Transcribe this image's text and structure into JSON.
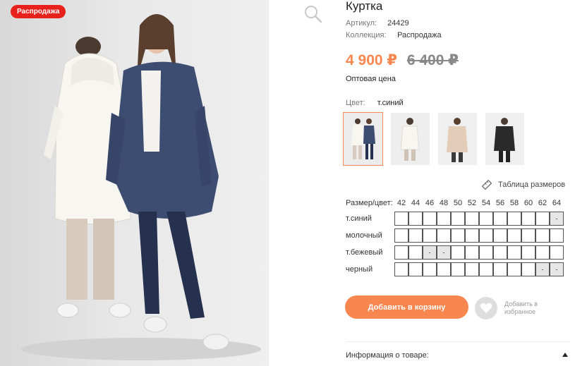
{
  "product": {
    "badge": "Распродажа",
    "title": "Куртка",
    "article_label": "Артикул:",
    "article_value": "24429",
    "collection_label": "Коллекция:",
    "collection_value": "Распродажа",
    "price_new": "4 900 ₽",
    "price_old": "6 400 ₽",
    "wholesale_label": "Оптовая цена",
    "color_label": "Цвет:",
    "color_value": "т.синий"
  },
  "colors": {
    "accent": "#f7864f",
    "badge": "#e8211c"
  },
  "swatches": [
    {
      "name": "т.синий",
      "selected": true
    },
    {
      "name": "молочный",
      "selected": false
    },
    {
      "name": "т.бежевый",
      "selected": false
    },
    {
      "name": "черный",
      "selected": false
    }
  ],
  "size_table_link": "Таблица размеров",
  "sizes": {
    "header_label": "Размер/цвет:",
    "columns": [
      "42",
      "44",
      "46",
      "48",
      "50",
      "52",
      "54",
      "56",
      "58",
      "60",
      "62",
      "64"
    ],
    "rows": [
      {
        "label": "т.синий",
        "cells": [
          "",
          "",
          "",
          "",
          "",
          "",
          "",
          "",
          "",
          "",
          "",
          "-"
        ]
      },
      {
        "label": "молочный",
        "cells": [
          "",
          "",
          "",
          "",
          "",
          "",
          "",
          "",
          "",
          "",
          "",
          ""
        ]
      },
      {
        "label": "т.бежевый",
        "cells": [
          "",
          "",
          "-",
          "-",
          "",
          "",
          "",
          "",
          "",
          "",
          "",
          ""
        ]
      },
      {
        "label": "черный",
        "cells": [
          "",
          "",
          "",
          "",
          "",
          "",
          "",
          "",
          "",
          "",
          "-",
          "-"
        ]
      }
    ]
  },
  "actions": {
    "add_to_cart": "Добавить в корзину",
    "favorite_line1": "Добавить в",
    "favorite_line2": "избранное"
  },
  "info_label": "Информация о товаре:",
  "icons": [
    "search-icon",
    "ruler-icon",
    "heart-icon",
    "triangle-up-icon"
  ]
}
